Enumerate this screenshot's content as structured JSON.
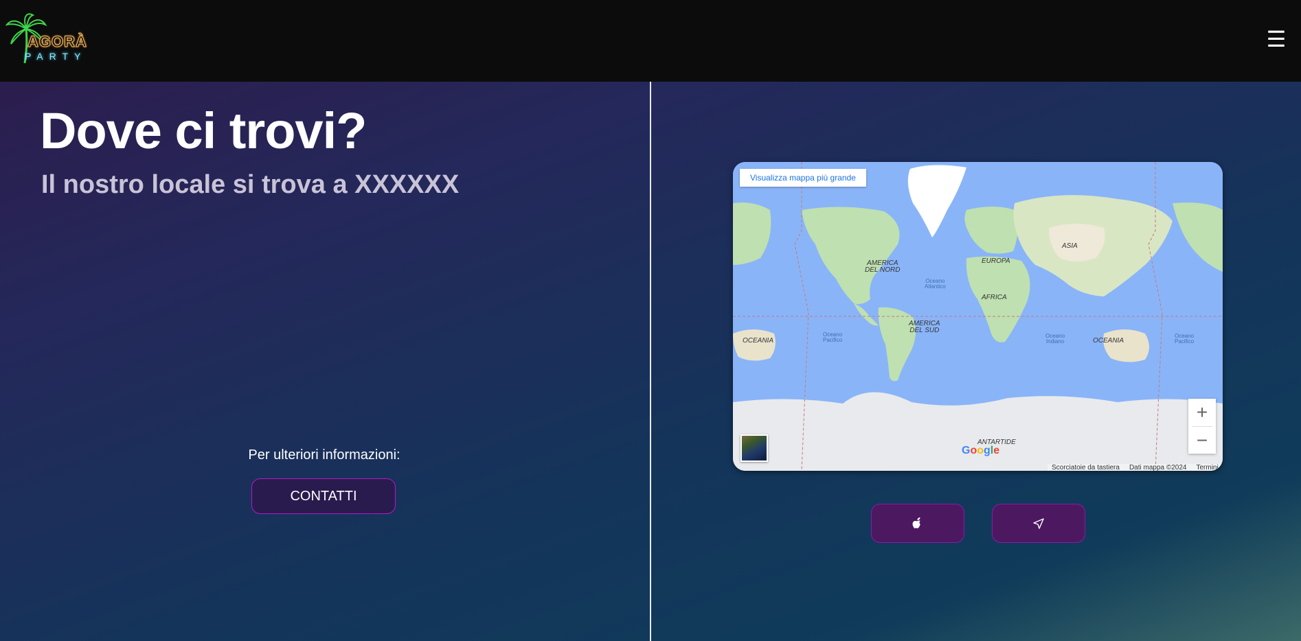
{
  "header": {
    "logo_word": "AGORÀ",
    "logo_sub": "PARTY",
    "menu_icon": "hamburger-menu-icon"
  },
  "main": {
    "title": "Dove ci trovi?",
    "subtitle": "Il nostro locale si trova a XXXXXX",
    "info_text": "Per ulteriori informazioni:",
    "contact_label": "CONTATTI"
  },
  "map": {
    "view_larger": "Visualizza mappa più grande",
    "zoom_in": "+",
    "zoom_out": "−",
    "shortcuts": "Scorciatoie da tastiera",
    "map_data": "Dati mappa ©2024",
    "terms": "Termini",
    "google_letters": [
      "G",
      "o",
      "o",
      "g",
      "l",
      "e"
    ],
    "labels": {
      "north_america": "AMERICA\nDEL NORD",
      "europe": "EUROPA",
      "asia": "ASIA",
      "africa": "AFRICA",
      "south_america": "AMERICA\nDEL SUD",
      "oceania_left": "OCEANIA",
      "oceania_right": "OCEANIA",
      "antarctica": "ANTARTIDE",
      "atlantic": "Oceano\nAtlantico",
      "pacific_left": "Oceano\nPacifico",
      "indian": "Oceano\nIndiano",
      "pacific_right": "Oceano\nPacifico"
    }
  },
  "actions": {
    "apple_maps_icon": "apple-icon",
    "navigate_icon": "navigation-arrow-icon"
  },
  "colors": {
    "header_bg": "#0c0c0c",
    "button_purple": "#4c1960",
    "button_border": "#b31ac7",
    "ocean": "#8ab4f8",
    "land": "#bfe0b0"
  }
}
